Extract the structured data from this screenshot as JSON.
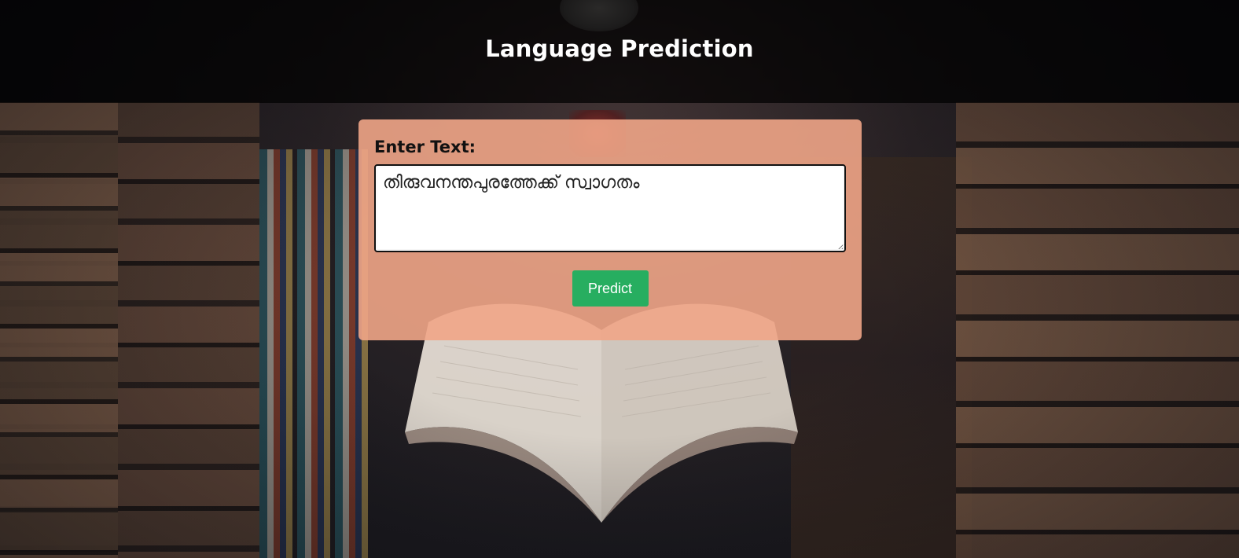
{
  "header": {
    "title": "Language Prediction"
  },
  "form": {
    "label": "Enter Text:",
    "text_value": "തിരുവനന്തപുരത്തേക്ക് സ്വാഗതം",
    "submit_label": "Predict"
  },
  "colors": {
    "header_bg": "#000000",
    "panel_bg": "#f0a587",
    "button_bg": "#27ae60",
    "button_text": "#ffffff"
  },
  "icons": {
    "background": "library-bookshelves-image"
  }
}
